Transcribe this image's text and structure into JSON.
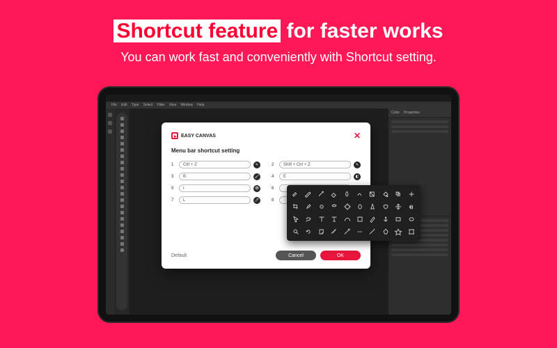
{
  "hero": {
    "highlight": "Shortcut feature",
    "rest": " for faster works",
    "sub": "You can work fast and conveniently with Shortcut setting."
  },
  "app": {
    "menus": [
      "File",
      "Edit",
      "Type",
      "Select",
      "Filter",
      "View",
      "Window",
      "Help"
    ],
    "right_tabs": [
      "Color",
      "Properties"
    ]
  },
  "dialog": {
    "brand": "EASY CANVAS",
    "title": "Menu bar shortcut setting",
    "default_label": "Default",
    "cancel": "Cancel",
    "ok": "OK",
    "rows": [
      {
        "n": "1",
        "v": "Ctrl + Z"
      },
      {
        "n": "2",
        "v": "Shift + Ctrl + Z"
      },
      {
        "n": "3",
        "v": "B"
      },
      {
        "n": "4",
        "v": "E"
      },
      {
        "n": "5",
        "v": "I"
      },
      {
        "n": "6",
        "v": ""
      },
      {
        "n": "7",
        "v": "L"
      },
      {
        "n": "8",
        "v": ""
      }
    ]
  },
  "picker_icons": [
    "brush",
    "pencil",
    "wand",
    "eraser",
    "blur",
    "smudge",
    "gradient",
    "bucket",
    "clone",
    "heal",
    "crop",
    "eyedrop",
    "spot",
    "patch",
    "dodge",
    "burn",
    "sharpen",
    "sponge",
    "move",
    "hand",
    "cursor",
    "lasso",
    "type",
    "type-v",
    "path",
    "shape",
    "pen",
    "anchor",
    "rect",
    "ellipse",
    "zoom",
    "rotate",
    "note",
    "measure",
    "slice",
    "count",
    "line",
    "polygon",
    "custom",
    "artboard"
  ]
}
